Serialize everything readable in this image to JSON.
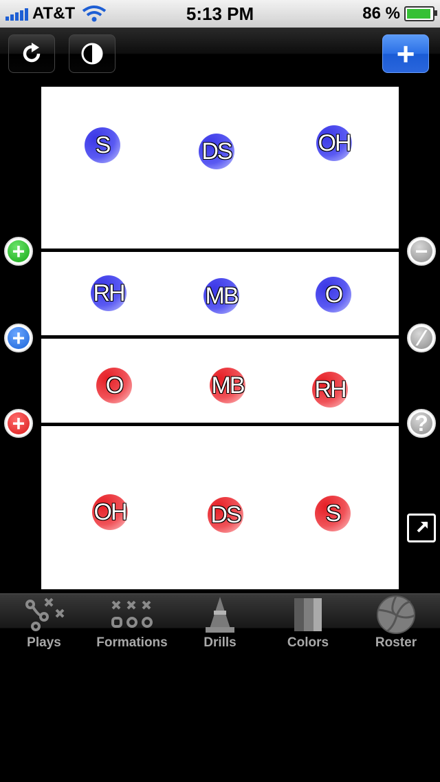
{
  "status_bar": {
    "carrier": "AT&T",
    "time": "5:13 PM",
    "battery": "86 %",
    "battery_level": 0.86
  },
  "toolbar": {
    "refresh_icon": "refresh-icon",
    "contrast_icon": "half-circle-icon",
    "add_label": "+"
  },
  "court": {
    "top_row": [
      "S",
      "DS",
      "OH"
    ],
    "blue_front": [
      "RH",
      "MB",
      "O"
    ],
    "red_front": [
      "O",
      "MB",
      "RH"
    ],
    "bottom_row": [
      "OH",
      "DS",
      "S"
    ],
    "colors": {
      "blue_team": "#3b37e6",
      "red_team": "#e61f25"
    }
  },
  "side_controls": {
    "left": [
      {
        "icon": "green-plus-icon",
        "glyph": "+"
      },
      {
        "icon": "blue-plus-icon",
        "glyph": "+"
      },
      {
        "icon": "red-plus-icon",
        "glyph": "+"
      }
    ],
    "right": [
      {
        "icon": "minus-icon",
        "glyph": "−"
      },
      {
        "icon": "pencil-icon",
        "glyph": "⁄"
      },
      {
        "icon": "help-icon",
        "glyph": "?"
      }
    ],
    "share_icon": "share-icon"
  },
  "tabs": [
    {
      "label": "Plays",
      "icon": "plays-icon"
    },
    {
      "label": "Formations",
      "icon": "formations-icon"
    },
    {
      "label": "Drills",
      "icon": "cone-icon"
    },
    {
      "label": "Colors",
      "icon": "colors-icon"
    },
    {
      "label": "Roster",
      "icon": "volleyball-icon"
    }
  ]
}
